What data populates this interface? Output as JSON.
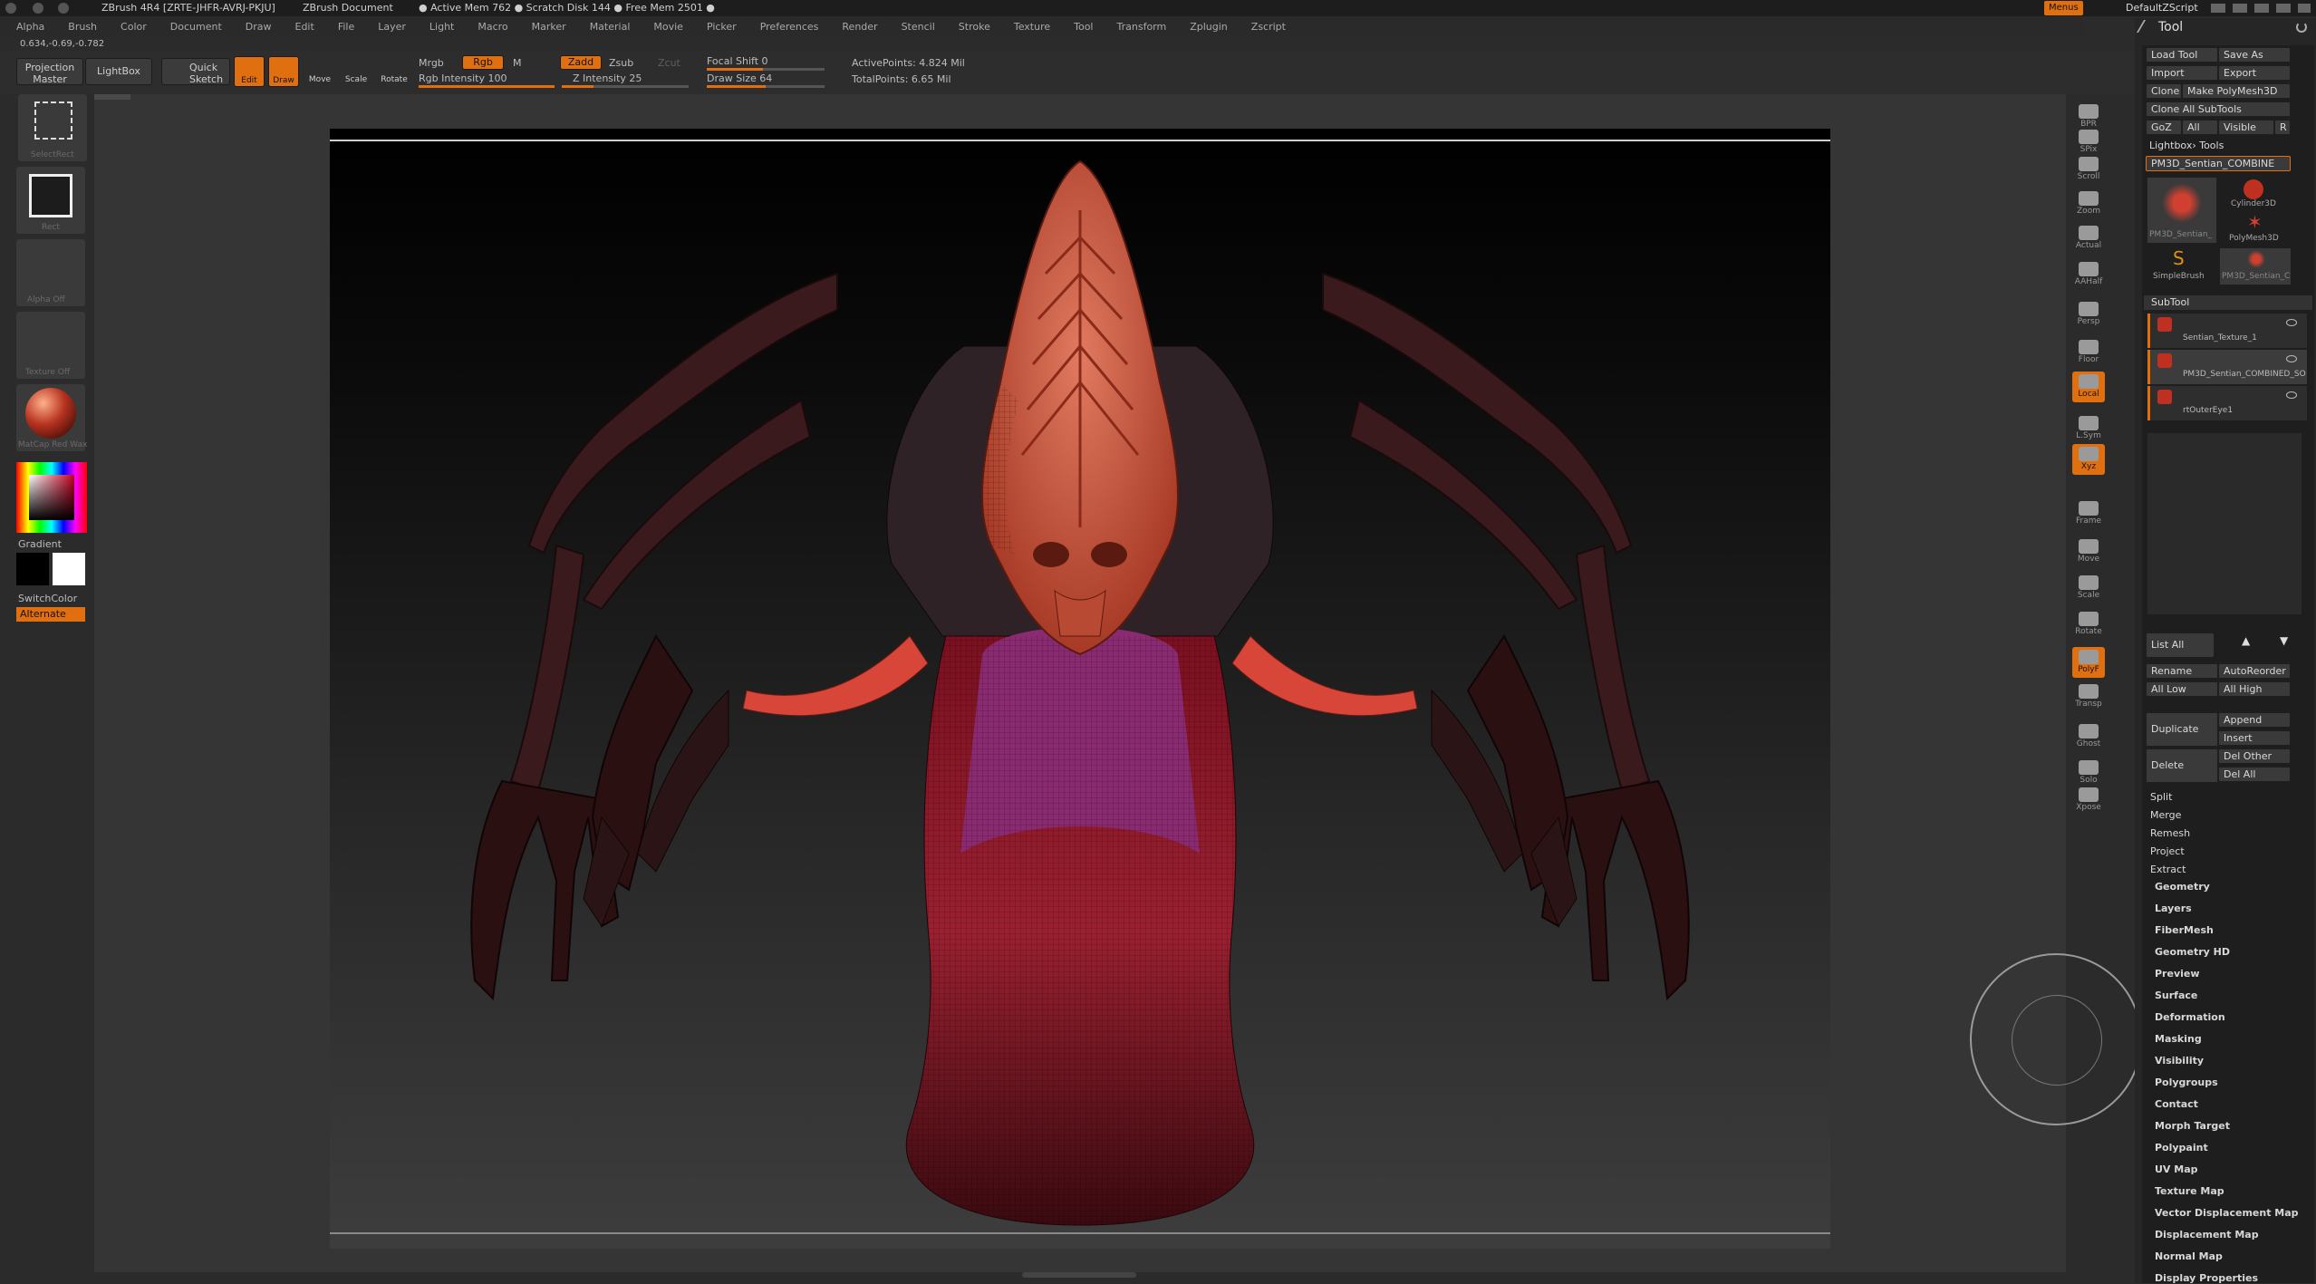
{
  "title_bar": {
    "app": "ZBrush 4R4 [ZRTE-JHFR-AVRJ-PKJU]",
    "document": "ZBrush Document",
    "memory": "● Active Mem 762 ● Scratch Disk 144 ● Free Mem 2501 ●",
    "menus_button": "Menus",
    "script": "DefaultZScript"
  },
  "menu_bar": [
    "Alpha",
    "Brush",
    "Color",
    "Document",
    "Draw",
    "Edit",
    "File",
    "Layer",
    "Light",
    "Macro",
    "Marker",
    "Material",
    "Movie",
    "Picker",
    "Preferences",
    "Render",
    "Stencil",
    "Stroke",
    "Texture",
    "Tool",
    "Transform",
    "Zplugin",
    "Zscript"
  ],
  "coords": "0.634,-0.69,-0.782",
  "top_shelf": {
    "projection_master": "Projection Master",
    "lightbox": "LightBox",
    "quick_sketch": "Quick Sketch",
    "edit": "Edit",
    "draw": "Draw",
    "move": "Move",
    "scale": "Scale",
    "rotate": "Rotate",
    "mrgb": "Mrgb",
    "rgb": "Rgb",
    "m": "M",
    "rgb_intensity": "Rgb Intensity 100",
    "zadd": "Zadd",
    "zsub": "Zsub",
    "zcut": "Zcut",
    "z_intensity": "Z Intensity 25",
    "focal_shift": "Focal Shift 0",
    "draw_size": "Draw Size 64",
    "active_points": "ActivePoints: 4.824 Mil",
    "total_points": "TotalPoints: 6.65 Mil",
    "rgb_intensity_value": 100,
    "z_intensity_value": 25,
    "draw_size_value": 64
  },
  "left_shelf": {
    "select_rect": "SelectRect",
    "rect": "Rect",
    "alpha_off": "Alpha Off",
    "texture_off": "Texture Off",
    "matcap": "MatCap Red Wax",
    "gradient": "Gradient",
    "switch_color": "SwitchColor",
    "alternate": "Alternate"
  },
  "right_shelf": [
    "BPR",
    "SPix",
    "Scroll",
    "Zoom",
    "Actual",
    "AAHalf",
    "Persp",
    "Floor",
    "Local",
    "L.Sym",
    "Xyz",
    "Frame",
    "Move",
    "Scale",
    "Rotate",
    "PolyF",
    "Transp",
    "Ghost",
    "Solo",
    "Xpose"
  ],
  "tool_panel": {
    "title": "Tool",
    "load_tool": "Load Tool",
    "save_as": "Save As",
    "import": "Import",
    "export": "Export",
    "clone": "Clone",
    "make_polymesh": "Make PolyMesh3D",
    "clone_all": "Clone All SubTools",
    "goz": "GoZ",
    "all": "All",
    "visible": "Visible",
    "r": "R",
    "lightbox_tools": "Lightbox› Tools",
    "current_tool": "PM3D_Sentian_COMBINE",
    "tool_thumbs": [
      "PM3D_Sentian_",
      "Cylinder3D",
      "PolyMesh3D",
      "SimpleBrush",
      "PM3D_Sentian_C"
    ],
    "subtool_header": "SubTool",
    "subtools": [
      "Sentian_Texture_1",
      "PM3D_Sentian_COMBINED_SO",
      "rtOuterEye1"
    ],
    "list_all": "List All",
    "rename": "Rename",
    "auto_reorder": "AutoReorder",
    "all_low": "All Low",
    "all_high": "All High",
    "duplicate": "Duplicate",
    "append": "Append",
    "insert": "Insert",
    "delete": "Delete",
    "del_other": "Del Other",
    "del_all": "Del All",
    "split": "Split",
    "merge": "Merge",
    "remesh": "Remesh",
    "project": "Project",
    "extract": "Extract",
    "sections": [
      "Geometry",
      "Layers",
      "FiberMesh",
      "Geometry HD",
      "Preview",
      "Surface",
      "Deformation",
      "Masking",
      "Visibility",
      "Polygroups",
      "Contact",
      "Morph Target",
      "Polypaint",
      "UV Map",
      "Texture Map",
      "Vector Displacement Map",
      "Displacement Map",
      "Normal Map",
      "Display Properties"
    ]
  }
}
